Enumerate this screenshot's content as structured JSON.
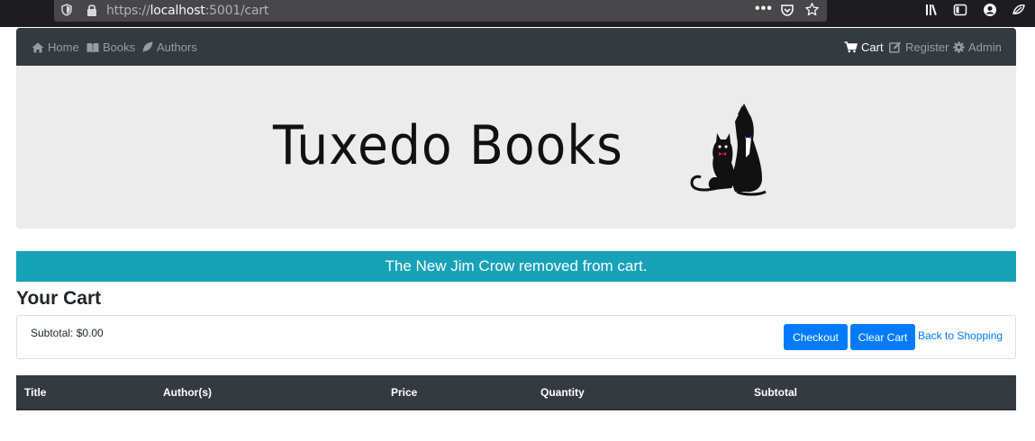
{
  "browser": {
    "url_scheme": "https://",
    "url_host": "localhost",
    "url_path": ":5001/cart",
    "page_actions_label": "•••"
  },
  "navbar": {
    "left": [
      {
        "label": "Home",
        "icon": "home-icon"
      },
      {
        "label": "Books",
        "icon": "book-open-icon"
      },
      {
        "label": "Authors",
        "icon": "feather-icon"
      }
    ],
    "right": [
      {
        "label": "Cart",
        "icon": "shopping-cart-icon",
        "active": true
      },
      {
        "label": "Register",
        "icon": "edit-icon"
      },
      {
        "label": "Admin",
        "icon": "gear-icon"
      }
    ]
  },
  "banner": {
    "logo_text": "Tuxedo Books"
  },
  "alert": {
    "message": "The New Jim Crow removed from cart.",
    "color": "#17a2b8"
  },
  "cart": {
    "title": "Your Cart",
    "subtotal": "Subtotal: $0.00",
    "checkout_label": "Checkout",
    "clear_label": "Clear Cart",
    "back_label": "Back to Shopping"
  },
  "table": {
    "headers": [
      "Title",
      "Author(s)",
      "Price",
      "Quantity",
      "Subtotal"
    ]
  },
  "colors": {
    "navbar": "#343a40",
    "primary": "#007bff",
    "info": "#17a2b8"
  }
}
